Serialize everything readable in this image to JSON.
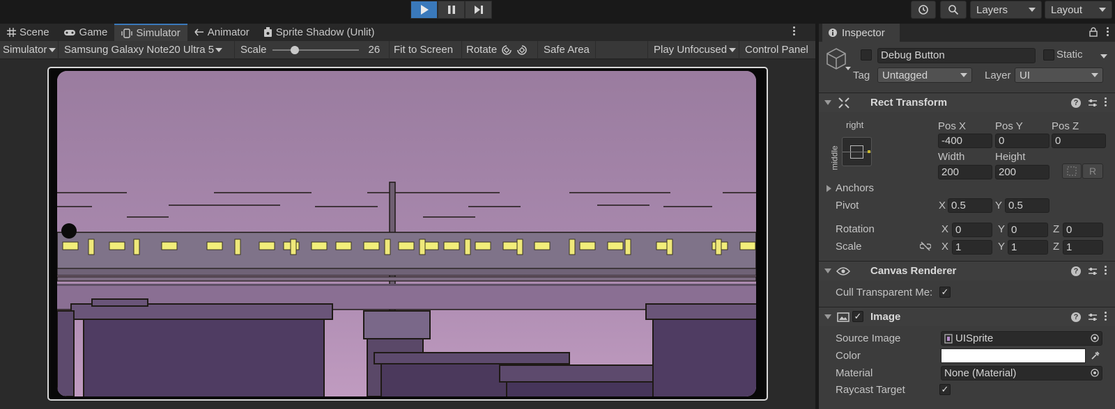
{
  "toolbar": {
    "layers_label": "Layers",
    "layout_label": "Layout",
    "icons": [
      "play-icon",
      "pause-icon",
      "step-icon",
      "history-icon",
      "search-icon"
    ],
    "accent_color": "#3a79bb"
  },
  "tabs": [
    {
      "label": "Scene",
      "icon": "grid-icon"
    },
    {
      "label": "Game",
      "icon": "gamepad-icon"
    },
    {
      "label": "Simulator",
      "icon": "device-icon"
    },
    {
      "label": "Animator",
      "icon": "animator-icon"
    },
    {
      "label": "Sprite Shadow (Unlit)",
      "icon": "shader-icon"
    }
  ],
  "simbar": {
    "mode": "Simulator",
    "device": "Samsung Galaxy Note20 Ultra 5",
    "scale_label": "Scale",
    "scale_value": "26",
    "scale_fraction": 0.23,
    "fit_label": "Fit to Screen",
    "rotate_label": "Rotate",
    "safe_area_label": "Safe Area",
    "play_mode": "Play Unfocused",
    "control_panel_label": "Control Panel"
  },
  "inspector": {
    "tab_label": "Inspector",
    "object_name": "Debug Button",
    "static_label": "Static",
    "tag_label": "Tag",
    "tag_value": "Untagged",
    "layer_label": "Layer",
    "layer_value": "UI",
    "rect_transform": {
      "title": "Rect Transform",
      "anchor_h": "right",
      "anchor_v": "middle",
      "pos_x_label": "Pos X",
      "pos_x": "-400",
      "pos_y_label": "Pos Y",
      "pos_y": "0",
      "pos_z_label": "Pos Z",
      "pos_z": "0",
      "width_label": "Width",
      "width": "200",
      "height_label": "Height",
      "height": "200",
      "r_label": "R",
      "anchors_label": "Anchors",
      "pivot_label": "Pivot",
      "pivot_x": "0.5",
      "pivot_y": "0.5",
      "rotation_label": "Rotation",
      "rot_x": "0",
      "rot_y": "0",
      "rot_z": "0",
      "scale_label": "Scale",
      "scale_x": "1",
      "scale_y": "1",
      "scale_z": "1",
      "x_label": "X",
      "y_label": "Y",
      "z_label": "Z"
    },
    "canvas_renderer": {
      "title": "Canvas Renderer",
      "cull_label": "Cull Transparent Me:",
      "cull_checked": "✓"
    },
    "image": {
      "title": "Image",
      "enabled_check": "✓",
      "source_label": "Source Image",
      "source_value": "UISprite",
      "color_label": "Color",
      "color_value": "#ffffff",
      "material_label": "Material",
      "material_value": "None (Material)",
      "raycast_label": "Raycast Target",
      "raycast_checked": "✓"
    }
  }
}
